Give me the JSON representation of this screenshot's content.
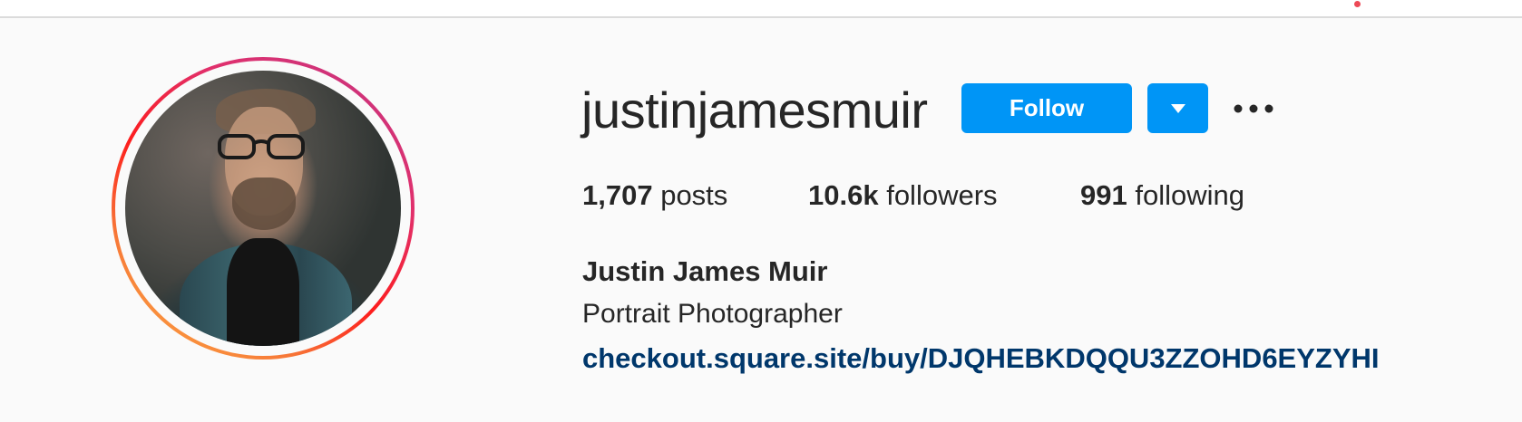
{
  "colors": {
    "accent": "#0095f6",
    "link": "#00376b",
    "text": "#262626",
    "background": "#fafafa",
    "notification": "#ed4956"
  },
  "profile": {
    "username": "justinjamesmuir",
    "full_name": "Justin James Muir",
    "bio": "Portrait Photographer",
    "link": "checkout.square.site/buy/DJQHEBKDQQU3ZZOHD6EYZYHI"
  },
  "actions": {
    "follow_label": "Follow",
    "dropdown_icon": "caret-down-icon",
    "more_icon": "more-horizontal-icon"
  },
  "stats": {
    "posts": {
      "count": "1,707",
      "label": "posts"
    },
    "followers": {
      "count": "10.6k",
      "label": "followers"
    },
    "following": {
      "count": "991",
      "label": "following"
    }
  }
}
